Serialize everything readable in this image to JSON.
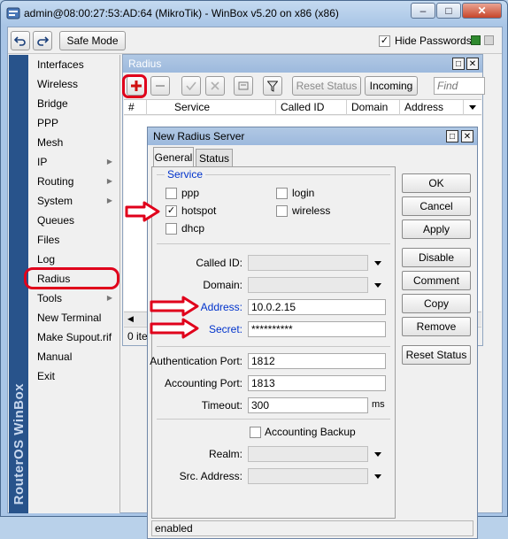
{
  "window": {
    "title": "admin@08:00:27:53:AD:64 (MikroTik) - WinBox v5.20 on x86 (x86)",
    "minimize_glyph": "–",
    "maximize_glyph": "□",
    "close_glyph": "✕"
  },
  "toolbar": {
    "undo_icon": "undo-icon",
    "redo_icon": "redo-icon",
    "safe_mode_label": "Safe Mode",
    "hide_passwords_label": "Hide Passwords",
    "hide_passwords_checked": "✓"
  },
  "sidebar": {
    "brand": "RouterOS WinBox",
    "items": [
      {
        "label": "Interfaces"
      },
      {
        "label": "Wireless"
      },
      {
        "label": "Bridge"
      },
      {
        "label": "PPP"
      },
      {
        "label": "Mesh"
      },
      {
        "label": "IP"
      },
      {
        "label": "Routing"
      },
      {
        "label": "System"
      },
      {
        "label": "Queues"
      },
      {
        "label": "Files"
      },
      {
        "label": "Log"
      },
      {
        "label": "Radius"
      },
      {
        "label": "Tools"
      },
      {
        "label": "New Terminal"
      },
      {
        "label": "Make Supout.rif"
      },
      {
        "label": "Manual"
      },
      {
        "label": "Exit"
      }
    ]
  },
  "radius_window": {
    "title": "Radius",
    "reset_status_label": "Reset Status",
    "incoming_label": "Incoming",
    "find_placeholder": "Find",
    "columns": [
      "#",
      "Service",
      "Called ID",
      "Domain",
      "Address"
    ],
    "footer_text": "0 ite"
  },
  "dialog": {
    "title": "New Radius Server",
    "tabs": [
      "General",
      "Status"
    ],
    "service_group_label": "Service",
    "services": [
      {
        "label": "ppp",
        "checked": ""
      },
      {
        "label": "login",
        "checked": ""
      },
      {
        "label": "hotspot",
        "checked": "✓"
      },
      {
        "label": "wireless",
        "checked": ""
      },
      {
        "label": "dhcp",
        "checked": ""
      }
    ],
    "called_id_label": "Called ID:",
    "domain_label": "Domain:",
    "address_label": "Address:",
    "address_value": "10.0.2.15",
    "secret_label": "Secret:",
    "secret_value": "**********",
    "auth_port_label": "Authentication Port:",
    "auth_port_value": "1812",
    "acct_port_label": "Accounting Port:",
    "acct_port_value": "1813",
    "timeout_label": "Timeout:",
    "timeout_value": "300",
    "timeout_unit": "ms",
    "accounting_backup_label": "Accounting Backup",
    "realm_label": "Realm:",
    "src_address_label": "Src. Address:",
    "buttons": [
      "OK",
      "Cancel",
      "Apply",
      "Disable",
      "Comment",
      "Copy",
      "Remove",
      "Reset Status"
    ],
    "status_text": "enabled"
  },
  "colors": {
    "annotation_red": "#e0001b",
    "highlight_label_blue": "#0033cc",
    "brand_strip": "#28538b"
  }
}
